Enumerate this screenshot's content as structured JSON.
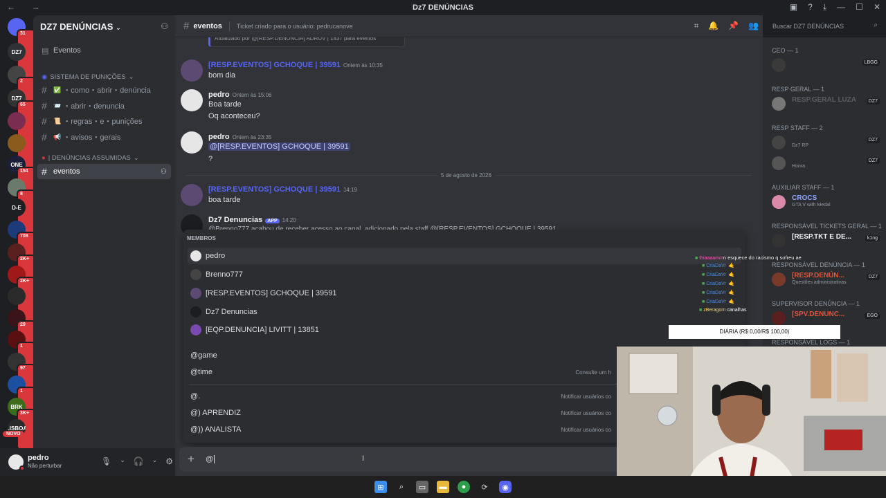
{
  "window": {
    "title": "Dz7 DENÚNCIAS"
  },
  "server_rail": [
    {
      "label": "",
      "badge": "31",
      "color": "#5865f2"
    },
    {
      "label": "DZ7",
      "badge": "",
      "color": "#2f3136"
    },
    {
      "label": "",
      "badge": "2",
      "color": "#444"
    },
    {
      "label": "DZ7",
      "badge": "65",
      "color": "#333"
    },
    {
      "label": "",
      "badge": "",
      "color": "#7a2d4e"
    },
    {
      "label": "",
      "badge": "",
      "color": "#8a5b1d"
    },
    {
      "label": "ONE",
      "badge": "154",
      "color": "#1b1f3a"
    },
    {
      "label": "",
      "badge": "8",
      "color": "#6b7b6b"
    },
    {
      "label": "D-E",
      "badge": "",
      "color": "#1e1f22"
    },
    {
      "label": "",
      "badge": "708",
      "color": "#1d3a7a"
    },
    {
      "label": "",
      "badge": "2K+",
      "color": "#5a2020"
    },
    {
      "label": "",
      "badge": "2K+",
      "color": "#a01818"
    },
    {
      "label": "",
      "badge": "",
      "color": "#2a2a2a"
    },
    {
      "label": "",
      "badge": "29",
      "color": "#3a1418"
    },
    {
      "label": "",
      "badge": "1",
      "color": "#5a1010"
    },
    {
      "label": "",
      "badge": "97",
      "color": "#333"
    },
    {
      "label": "",
      "badge": "1",
      "color": "#1d4fa0"
    },
    {
      "label": "BRK",
      "badge": "3K+",
      "color": "#3c6d1a"
    },
    {
      "label": "LISBOA",
      "badge": "",
      "color": "#2a2a2a"
    }
  ],
  "novo_badge": "NOVO",
  "sidebar": {
    "guild_name": "DZ7 DENÚNCIAS",
    "events_label": "Eventos",
    "category1": "SISTEMA DE PUNIÇÕES",
    "channels": [
      {
        "name": "・como・abrir・denúncia",
        "emoji": "✅"
      },
      {
        "name": "・abrir・denuncia",
        "emoji": "📨"
      },
      {
        "name": "・regras・e・punições",
        "emoji": "📜"
      },
      {
        "name": "・avisos・gerais",
        "emoji": "📢"
      }
    ],
    "category2": "| DENÚNCIAS ASSUMIDAS",
    "active_channel": "eventos"
  },
  "user_panel": {
    "name": "pedro",
    "status": "Não perturbar"
  },
  "chat_header": {
    "channel": "eventos",
    "topic": "Ticket criado para o usuário: pedrucanove"
  },
  "search": {
    "placeholder": "Buscar DZ7 DENÚNCIAS"
  },
  "messages": {
    "top_snippet": "Atualizado por @[RESP.DENUNCIA] ADRUV | 1837 para eventos",
    "m1_author": "[RESP.EVENTOS] GCHOQUE | 39591",
    "m1_time": "Ontem às 10:35",
    "m1_text": "bom dia",
    "m2_author": "pedro",
    "m2_time": "Ontem às 15:06",
    "m2_text1": "Boa tarde",
    "m2_text2": "Oq aconteceu?",
    "m3_author": "pedro",
    "m3_time": "Ontem às 23:35",
    "m3_mention": "@[RESP.EVENTOS] GCHOQUE | 39591",
    "m3_text": "?",
    "date_divider": "5 de agosto de 2026",
    "m4_author": "[RESP.EVENTOS] GCHOQUE | 39591",
    "m4_time": "14:19",
    "m4_text": "boa tarde",
    "m5_author": "Dz7 Denuncias",
    "m5_tag": "APP",
    "m5_time": "14:20",
    "m5_text": "@Brenno777 acabou de receber acesso ao canal, adicionado pela staff @[RESP.EVENTOS] GCHOQUE | 39591"
  },
  "popup": {
    "members_header": "MEMBROS",
    "members": [
      "pedro",
      "Brenno777",
      "[RESP.EVENTOS] GCHOQUE | 39591",
      "Dz7 Denuncias",
      "[EQP.DENUNCIA] LIVITT | 13851"
    ],
    "commands": [
      {
        "label": "@game",
        "hint": ""
      },
      {
        "label": "@time",
        "hint": "Consulte um h"
      }
    ],
    "roles": [
      {
        "label": "@.",
        "hint": "Notificar usuários co"
      },
      {
        "label": "@) APRENDIZ",
        "hint": "Notificar usuários co"
      },
      {
        "label": "@)) ANALISTA",
        "hint": "Notificar usuários co"
      }
    ]
  },
  "composer": {
    "value": "@"
  },
  "members_list": {
    "groups": [
      {
        "header": "CEO — 1",
        "rows": [
          {
            "name": "",
            "sub": "",
            "tag": "LBGG",
            "color": "#f2f3f5"
          }
        ]
      },
      {
        "header": "RESP GERAL — 1",
        "rows": [
          {
            "name": "RESP.GERAL LUZA",
            "sub": "",
            "tag": "DZ7",
            "color": "#5b5d63"
          }
        ]
      },
      {
        "header": "RESP STAFF — 2",
        "rows": [
          {
            "name": "",
            "sub": "Dz7 RP",
            "tag": "DZ7",
            "color": "#f2f3f5"
          },
          {
            "name": "",
            "sub": "Honra.",
            "tag": "DZ7",
            "color": "#f2f3f5"
          }
        ]
      },
      {
        "header": "AUXILIAR STAFF — 1",
        "rows": [
          {
            "name": "CROCS",
            "sub": "GTA V with Medal",
            "tag": "",
            "color": "#8fa8ff"
          }
        ]
      },
      {
        "header": "RESPONSÁVEL TICKETS GERAL — 1",
        "rows": [
          {
            "name": "[RESP.TKT E DE...",
            "sub": "",
            "tag": "k1ng",
            "color": "#f2f3f5"
          }
        ]
      },
      {
        "header": "RESPONSÁVEL DENÚNCIA — 1",
        "rows": [
          {
            "name": "[RESP.DENÚN...",
            "sub": "Questões administrativas",
            "tag": "DZ7",
            "color": "#e2553b"
          }
        ]
      },
      {
        "header": "SUPERVISOR DENÚNCIA — 1",
        "rows": [
          {
            "name": "[SPV.DENUNC...",
            "sub": "",
            "tag": "EGO",
            "color": "#e2553b"
          }
        ]
      },
      {
        "header": "RESPONSÁVEL LOGS — 1",
        "rows": []
      }
    ]
  },
  "stream_overlay": {
    "chat_line": "n esquece do racismo q sofreu ae",
    "chat_author": "thiaaaamm",
    "names": [
      "CriaDaVr",
      "CriaDaVr",
      "CriaDaVr",
      "CriaDaVr",
      "CriaDaVr"
    ],
    "last_line_author": "zBeragorn",
    "last_line_text": "canalhas",
    "bar_label": "DIÁRIA (R$ 0,00/R$ 100,00)"
  }
}
